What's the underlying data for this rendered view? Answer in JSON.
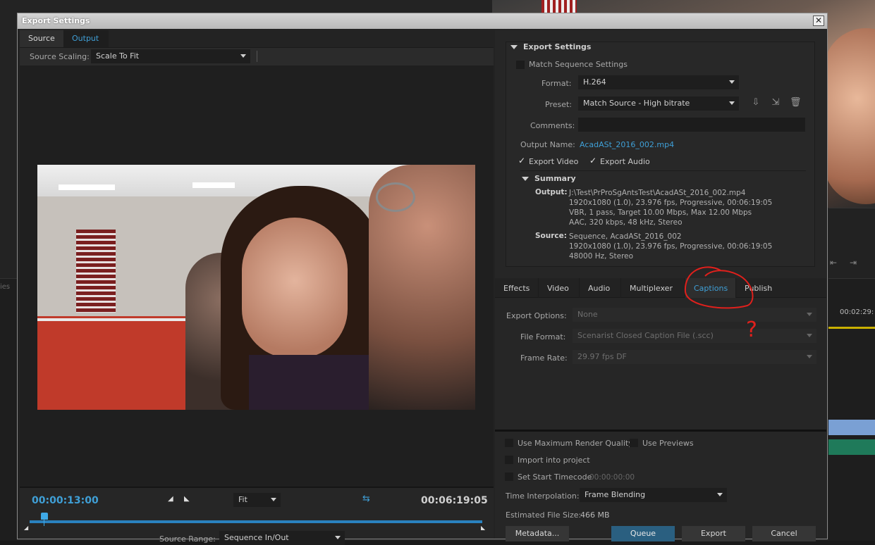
{
  "dialog": {
    "title": "Export Settings",
    "close_glyph": "✕"
  },
  "left": {
    "tabs": [
      {
        "label": "Source"
      },
      {
        "label": "Output"
      }
    ],
    "source_scaling_label": "Source Scaling:",
    "source_scaling_value": "Scale To Fit",
    "current_timecode": "00:00:13:00",
    "end_timecode": "00:06:19:05",
    "zoom_value": "Fit",
    "source_range_label": "Source Range:",
    "source_range_value": "Sequence In/Out"
  },
  "export_settings": {
    "header": "Export Settings",
    "match_sequence_label": "Match Sequence Settings",
    "match_sequence_checked": false,
    "format_label": "Format:",
    "format_value": "H.264",
    "preset_label": "Preset:",
    "preset_value": "Match Source - High bitrate",
    "comments_label": "Comments:",
    "comments_value": "",
    "output_name_label": "Output Name:",
    "output_name_value": "AcadASt_2016_002.mp4",
    "export_video_label": "Export Video",
    "export_video_checked": true,
    "export_audio_label": "Export Audio",
    "export_audio_checked": true
  },
  "summary": {
    "header": "Summary",
    "output_label": "Output:",
    "output_lines": [
      "J:\\Test\\PrProSgAntsTest\\AcadASt_2016_002.mp4",
      "1920x1080 (1.0), 23.976 fps, Progressive, 00:06:19:05",
      "VBR, 1 pass, Target 10.00 Mbps, Max 12.00 Mbps",
      "AAC, 320 kbps, 48 kHz, Stereo"
    ],
    "source_label": "Source:",
    "source_lines": [
      "Sequence, AcadASt_2016_002",
      "1920x1080 (1.0), 23.976 fps, Progressive, 00:06:19:05",
      "48000 Hz, Stereo"
    ]
  },
  "settings_tabs": [
    {
      "label": "Effects"
    },
    {
      "label": "Video"
    },
    {
      "label": "Audio"
    },
    {
      "label": "Multiplexer"
    },
    {
      "label": "Captions",
      "active": true
    },
    {
      "label": "Publish"
    }
  ],
  "captions": {
    "export_options_label": "Export Options:",
    "export_options_value": "None",
    "file_format_label": "File Format:",
    "file_format_value": "Scenarist Closed Caption File (.scc)",
    "frame_rate_label": "Frame Rate:",
    "frame_rate_value": "29.97 fps DF"
  },
  "bottom": {
    "max_render_quality_label": "Use Maximum Render Quality",
    "use_previews_label": "Use Previews",
    "import_into_project_label": "Import into project",
    "set_start_timecode_label": "Set Start Timecode",
    "start_timecode_value": "00:00:00:00",
    "time_interpolation_label": "Time Interpolation:",
    "time_interpolation_value": "Frame Blending",
    "estimated_size_label": "Estimated File Size:",
    "estimated_size_value": "466 MB",
    "metadata_button": "Metadata...",
    "queue_button": "Queue",
    "export_button": "Export",
    "cancel_button": "Cancel"
  },
  "background_app": {
    "timecode": "00:02:29:",
    "panel_label": "ies"
  },
  "annotations": {
    "question_mark": "?"
  },
  "colors": {
    "accent_blue": "#3f9fd6",
    "queue_button": "#2a5f80",
    "annotation_red": "#e0201c"
  }
}
